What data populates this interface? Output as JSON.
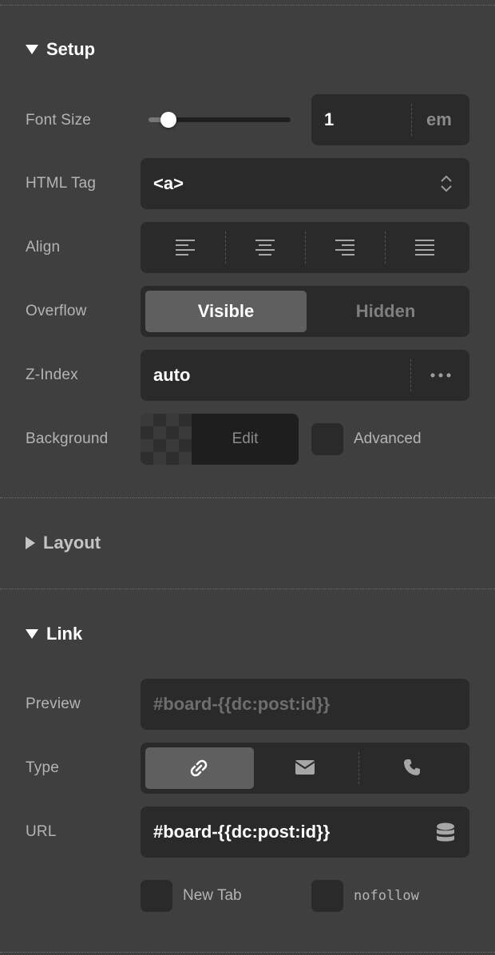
{
  "sections": {
    "setup": {
      "title": "Setup"
    },
    "layout": {
      "title": "Layout"
    },
    "link": {
      "title": "Link"
    }
  },
  "setup": {
    "font_size": {
      "label": "Font Size",
      "value": "1",
      "unit": "em",
      "slider_fraction": 0.14
    },
    "html_tag": {
      "label": "HTML Tag",
      "value": "<a>"
    },
    "align": {
      "label": "Align",
      "options": [
        "align-left",
        "align-center",
        "align-right",
        "align-justify"
      ]
    },
    "overflow": {
      "label": "Overflow",
      "options": [
        "Visible",
        "Hidden"
      ],
      "selected": "Visible"
    },
    "z_index": {
      "label": "Z-Index",
      "value": "auto"
    },
    "background": {
      "label": "Background",
      "edit_label": "Edit",
      "advanced_label": "Advanced"
    }
  },
  "link": {
    "preview": {
      "label": "Preview",
      "value": "#board-{{dc:post:id}}"
    },
    "type": {
      "label": "Type",
      "options": [
        "link-icon",
        "mail-icon",
        "phone-icon"
      ],
      "selected": "link-icon"
    },
    "url": {
      "label": "URL",
      "value": "#board-{{dc:post:id}}"
    },
    "new_tab_label": "New Tab",
    "nofollow_label": "nofollow"
  },
  "colors": {
    "background": "#3f3f3f",
    "control": "#2a2a2a",
    "active_segment": "#5f5f5f"
  }
}
